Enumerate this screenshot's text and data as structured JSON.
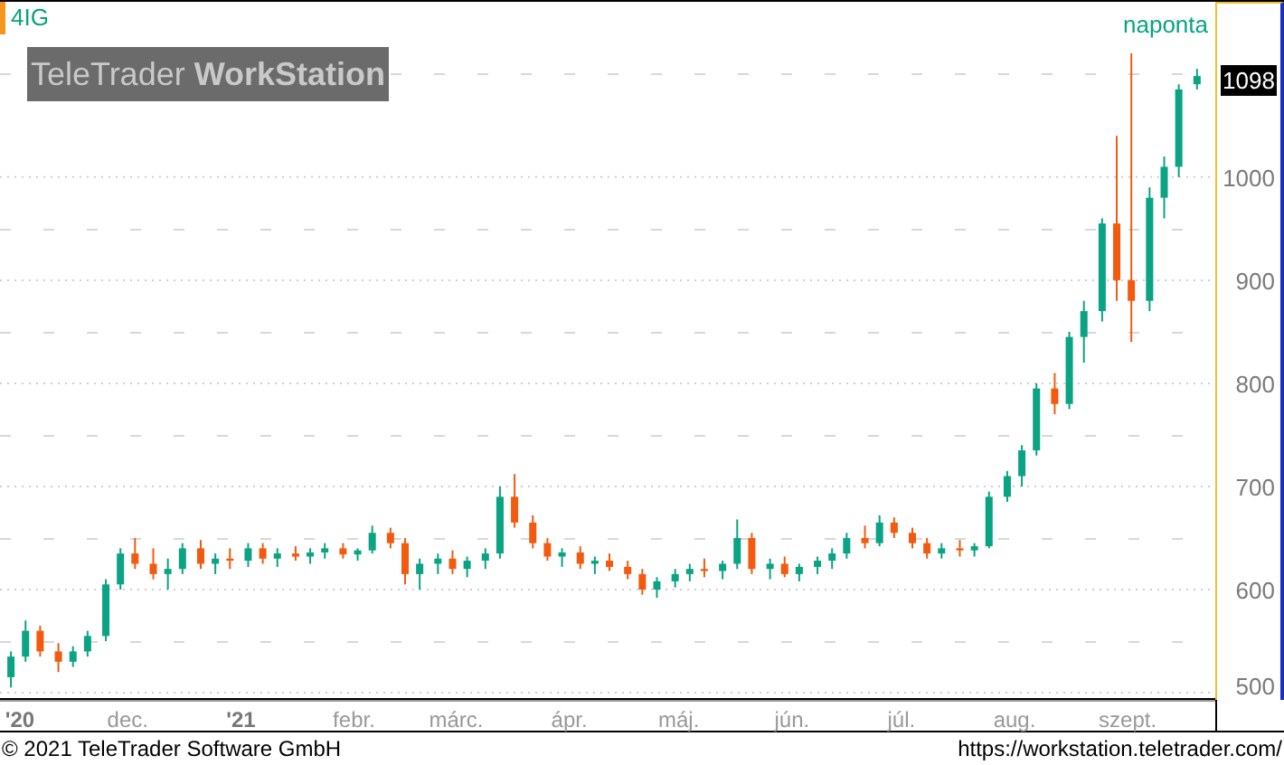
{
  "instrument": {
    "symbol": "4IG"
  },
  "logo": {
    "brand": "TeleTrader",
    "product": "WorkStation"
  },
  "interval": "naponta",
  "last_price": "1098",
  "time_axis_bold": [
    true,
    false,
    true,
    false,
    false,
    false,
    false,
    false,
    false,
    false,
    false
  ],
  "chart_data": {
    "type": "candlestick",
    "grid": true,
    "ylim": [
      493,
      1170
    ],
    "xlim": [
      "2020-10-27",
      "2021-09-25"
    ],
    "xticks": [
      {
        "value": "2020-11-01",
        "label": "'20"
      },
      {
        "value": "2020-12-01",
        "label": "dec."
      },
      {
        "value": "2021-01-01",
        "label": "'21"
      },
      {
        "value": "2021-02-01",
        "label": "febr."
      },
      {
        "value": "2021-03-01",
        "label": "márc."
      },
      {
        "value": "2021-04-01",
        "label": "ápr."
      },
      {
        "value": "2021-05-01",
        "label": "máj."
      },
      {
        "value": "2021-06-01",
        "label": "jún."
      },
      {
        "value": "2021-07-01",
        "label": "júl."
      },
      {
        "value": "2021-08-01",
        "label": "aug."
      },
      {
        "value": "2021-09-01",
        "label": "szept."
      }
    ],
    "yticks": [
      {
        "value": 1000,
        "label": "1000"
      },
      {
        "value": 900,
        "label": "900"
      },
      {
        "value": 800,
        "label": "800"
      },
      {
        "value": 700,
        "label": "700"
      },
      {
        "value": 600,
        "label": "600"
      },
      {
        "value": 500,
        "label": "500"
      }
    ],
    "x": [
      "2020-10-30",
      "2020-11-03",
      "2020-11-07",
      "2020-11-12",
      "2020-11-16",
      "2020-11-20",
      "2020-11-25",
      "2020-11-29",
      "2020-12-03",
      "2020-12-08",
      "2020-12-12",
      "2020-12-16",
      "2020-12-21",
      "2020-12-25",
      "2020-12-29",
      "2021-01-03",
      "2021-01-07",
      "2021-01-11",
      "2021-01-16",
      "2021-01-20",
      "2021-01-24",
      "2021-01-29",
      "2021-02-02",
      "2021-02-06",
      "2021-02-11",
      "2021-02-15",
      "2021-02-19",
      "2021-02-24",
      "2021-02-28",
      "2021-03-04",
      "2021-03-09",
      "2021-03-13",
      "2021-03-17",
      "2021-03-22",
      "2021-03-26",
      "2021-03-30",
      "2021-04-04",
      "2021-04-08",
      "2021-04-12",
      "2021-04-17",
      "2021-04-21",
      "2021-04-25",
      "2021-04-30",
      "2021-05-04",
      "2021-05-08",
      "2021-05-13",
      "2021-05-17",
      "2021-05-21",
      "2021-05-26",
      "2021-05-30",
      "2021-06-03",
      "2021-06-08",
      "2021-06-12",
      "2021-06-16",
      "2021-06-21",
      "2021-06-25",
      "2021-06-29",
      "2021-07-04",
      "2021-07-08",
      "2021-07-12",
      "2021-07-17",
      "2021-07-21",
      "2021-07-25",
      "2021-07-30",
      "2021-08-03",
      "2021-08-07",
      "2021-08-12",
      "2021-08-16",
      "2021-08-20",
      "2021-08-25",
      "2021-08-29",
      "2021-09-02",
      "2021-09-07",
      "2021-09-11",
      "2021-09-15",
      "2021-09-20"
    ],
    "ohlc": [
      [
        515,
        540,
        505,
        535
      ],
      [
        535,
        570,
        530,
        560
      ],
      [
        560,
        565,
        535,
        540
      ],
      [
        540,
        548,
        520,
        530
      ],
      [
        530,
        545,
        525,
        540
      ],
      [
        540,
        560,
        535,
        555
      ],
      [
        555,
        610,
        550,
        605
      ],
      [
        605,
        640,
        600,
        635
      ],
      [
        635,
        650,
        620,
        625
      ],
      [
        625,
        640,
        610,
        615
      ],
      [
        615,
        630,
        600,
        620
      ],
      [
        620,
        645,
        615,
        640
      ],
      [
        640,
        648,
        620,
        625
      ],
      [
        625,
        635,
        615,
        630
      ],
      [
        630,
        640,
        620,
        628
      ],
      [
        628,
        645,
        622,
        640
      ],
      [
        640,
        645,
        625,
        630
      ],
      [
        630,
        640,
        622,
        635
      ],
      [
        635,
        642,
        628,
        632
      ],
      [
        632,
        640,
        625,
        636
      ],
      [
        636,
        645,
        630,
        640
      ],
      [
        640,
        645,
        630,
        634
      ],
      [
        634,
        640,
        628,
        638
      ],
      [
        638,
        662,
        635,
        655
      ],
      [
        655,
        660,
        640,
        645
      ],
      [
        645,
        650,
        605,
        615
      ],
      [
        615,
        630,
        600,
        625
      ],
      [
        625,
        635,
        615,
        630
      ],
      [
        630,
        638,
        615,
        620
      ],
      [
        620,
        632,
        612,
        628
      ],
      [
        628,
        640,
        620,
        635
      ],
      [
        635,
        700,
        630,
        690
      ],
      [
        690,
        712,
        660,
        665
      ],
      [
        665,
        672,
        640,
        645
      ],
      [
        645,
        650,
        628,
        632
      ],
      [
        632,
        640,
        622,
        636
      ],
      [
        636,
        642,
        620,
        625
      ],
      [
        625,
        632,
        615,
        628
      ],
      [
        628,
        635,
        618,
        622
      ],
      [
        622,
        628,
        610,
        615
      ],
      [
        615,
        620,
        595,
        600
      ],
      [
        600,
        612,
        592,
        608
      ],
      [
        608,
        620,
        602,
        615
      ],
      [
        615,
        625,
        608,
        620
      ],
      [
        620,
        630,
        612,
        618
      ],
      [
        618,
        628,
        610,
        625
      ],
      [
        625,
        668,
        620,
        650
      ],
      [
        650,
        655,
        615,
        620
      ],
      [
        620,
        630,
        610,
        625
      ],
      [
        625,
        632,
        612,
        615
      ],
      [
        615,
        625,
        608,
        622
      ],
      [
        622,
        632,
        615,
        628
      ],
      [
        628,
        640,
        620,
        635
      ],
      [
        635,
        655,
        630,
        650
      ],
      [
        650,
        662,
        640,
        645
      ],
      [
        645,
        672,
        642,
        665
      ],
      [
        665,
        670,
        650,
        655
      ],
      [
        655,
        660,
        640,
        645
      ],
      [
        645,
        650,
        630,
        635
      ],
      [
        635,
        645,
        630,
        640
      ],
      [
        640,
        648,
        632,
        638
      ],
      [
        638,
        645,
        632,
        642
      ],
      [
        642,
        695,
        640,
        690
      ],
      [
        690,
        715,
        685,
        710
      ],
      [
        710,
        740,
        700,
        735
      ],
      [
        735,
        800,
        730,
        795
      ],
      [
        795,
        810,
        770,
        780
      ],
      [
        780,
        850,
        775,
        845
      ],
      [
        845,
        880,
        820,
        870
      ],
      [
        870,
        960,
        860,
        955
      ],
      [
        955,
        1040,
        880,
        900
      ],
      [
        900,
        1120,
        840,
        880
      ],
      [
        880,
        990,
        870,
        980
      ],
      [
        980,
        1020,
        960,
        1010
      ],
      [
        1010,
        1090,
        1000,
        1085
      ],
      [
        1090,
        1105,
        1085,
        1098
      ]
    ]
  },
  "footer": {
    "copyright": "© 2021 TeleTrader Software GmbH",
    "url": "https://workstation.teletrader.com/"
  }
}
